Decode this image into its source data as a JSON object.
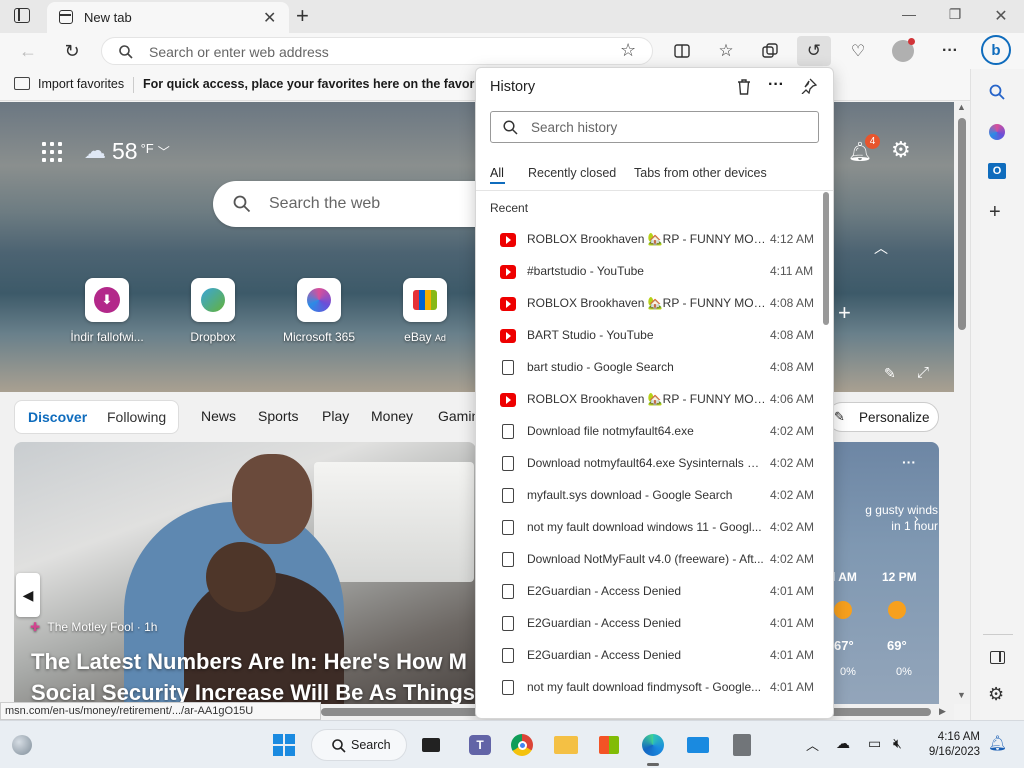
{
  "browser": {
    "tab_title": "New tab",
    "address_placeholder": "Search or enter web address",
    "favorites": {
      "import_label": "Import favorites",
      "hint": "For quick access, place your favorites here on the favorites ba"
    }
  },
  "newtab": {
    "weather": {
      "temp": "58",
      "unit": "°F"
    },
    "search_placeholder": "Search the web",
    "quick_links": [
      {
        "label": "İndir fallofwi..."
      },
      {
        "label": "Dropbox"
      },
      {
        "label": "Microsoft 365"
      },
      {
        "label": "eBay",
        "ad": "Ad"
      }
    ],
    "notification_count": "4",
    "feed_tabs": {
      "discover": "Discover",
      "following": "Following",
      "items": [
        "News",
        "Sports",
        "Play",
        "Money",
        "Gamin"
      ]
    },
    "personalize_label": "Personalize",
    "article": {
      "source": "The Motley Fool · 1h",
      "headline_line1": "The Latest Numbers Are In: Here's How M",
      "headline_line2": "Social Security Increase Will Be As Things"
    },
    "weather_card": {
      "alert_line1": "g gusty winds",
      "alert_line2": "in 1 hour",
      "times": [
        "l AM",
        "12 PM"
      ],
      "temps": [
        "67°",
        "69°"
      ],
      "precip": [
        "0%",
        "0%"
      ]
    }
  },
  "history": {
    "title": "History",
    "search_placeholder": "Search history",
    "filters": [
      "All",
      "Recently closed",
      "Tabs from other devices"
    ],
    "section": "Recent",
    "items": [
      {
        "type": "youtube",
        "title": "ROBLOX Brookhaven 🏡RP - FUNNY MOM...",
        "time": "4:12 AM"
      },
      {
        "type": "youtube",
        "title": "#bartstudio - YouTube",
        "time": "4:11 AM"
      },
      {
        "type": "youtube",
        "title": "ROBLOX Brookhaven 🏡RP - FUNNY MOM...",
        "time": "4:08 AM"
      },
      {
        "type": "youtube",
        "title": "BART Studio - YouTube",
        "time": "4:08 AM"
      },
      {
        "type": "page",
        "title": "bart studio - Google Search",
        "time": "4:08 AM"
      },
      {
        "type": "youtube",
        "title": "ROBLOX Brookhaven 🏡RP - FUNNY MOM...",
        "time": "4:06 AM"
      },
      {
        "type": "page",
        "title": "Download file notmyfault64.exe",
        "time": "4:02 AM"
      },
      {
        "type": "page",
        "title": "Download notmyfault64.exe Sysinternals M...",
        "time": "4:02 AM"
      },
      {
        "type": "page",
        "title": "myfault.sys download - Google Search",
        "time": "4:02 AM"
      },
      {
        "type": "page",
        "title": "not my fault download windows 11 - Googl...",
        "time": "4:02 AM"
      },
      {
        "type": "page",
        "title": "Download NotMyFault v4.0 (freeware) - Aft...",
        "time": "4:02 AM"
      },
      {
        "type": "page",
        "title": "E2Guardian - Access Denied",
        "time": "4:01 AM"
      },
      {
        "type": "page",
        "title": "E2Guardian - Access Denied",
        "time": "4:01 AM"
      },
      {
        "type": "page",
        "title": "E2Guardian - Access Denied",
        "time": "4:01 AM"
      },
      {
        "type": "page",
        "title": "not my fault download findmysoft - Google...",
        "time": "4:01 AM"
      }
    ]
  },
  "status_url": "msn.com/en-us/money/retirement/.../ar-AA1gO15U",
  "taskbar": {
    "search_label": "Search",
    "time": "4:16 AM",
    "date": "9/16/2023"
  },
  "colors": {
    "accent": "#0f6cbd",
    "youtube": "#ff0000",
    "notification_badge": "#e8552d"
  }
}
